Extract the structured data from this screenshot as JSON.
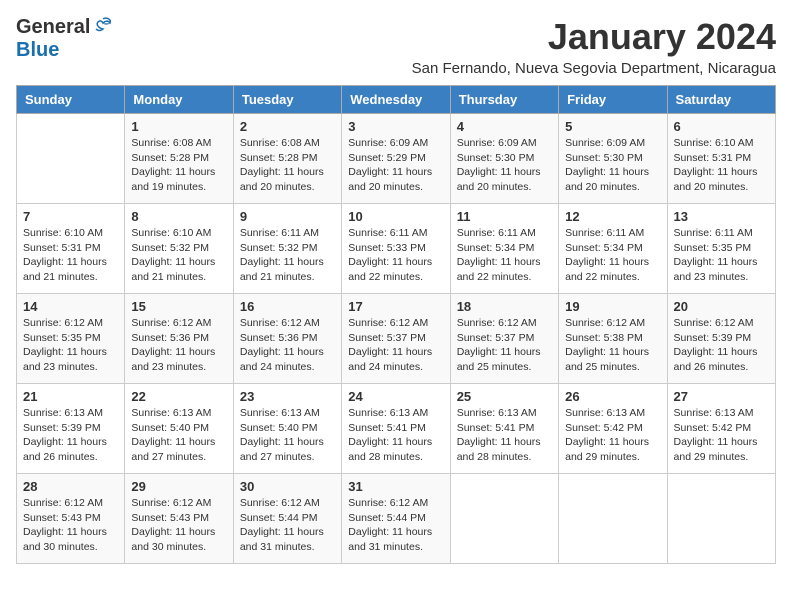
{
  "logo": {
    "general": "General",
    "blue": "Blue"
  },
  "title": "January 2024",
  "location": "San Fernando, Nueva Segovia Department, Nicaragua",
  "headers": [
    "Sunday",
    "Monday",
    "Tuesday",
    "Wednesday",
    "Thursday",
    "Friday",
    "Saturday"
  ],
  "weeks": [
    [
      {
        "day": "",
        "sunrise": "",
        "sunset": "",
        "daylight": ""
      },
      {
        "day": "1",
        "sunrise": "Sunrise: 6:08 AM",
        "sunset": "Sunset: 5:28 PM",
        "daylight": "Daylight: 11 hours and 19 minutes."
      },
      {
        "day": "2",
        "sunrise": "Sunrise: 6:08 AM",
        "sunset": "Sunset: 5:28 PM",
        "daylight": "Daylight: 11 hours and 20 minutes."
      },
      {
        "day": "3",
        "sunrise": "Sunrise: 6:09 AM",
        "sunset": "Sunset: 5:29 PM",
        "daylight": "Daylight: 11 hours and 20 minutes."
      },
      {
        "day": "4",
        "sunrise": "Sunrise: 6:09 AM",
        "sunset": "Sunset: 5:30 PM",
        "daylight": "Daylight: 11 hours and 20 minutes."
      },
      {
        "day": "5",
        "sunrise": "Sunrise: 6:09 AM",
        "sunset": "Sunset: 5:30 PM",
        "daylight": "Daylight: 11 hours and 20 minutes."
      },
      {
        "day": "6",
        "sunrise": "Sunrise: 6:10 AM",
        "sunset": "Sunset: 5:31 PM",
        "daylight": "Daylight: 11 hours and 20 minutes."
      }
    ],
    [
      {
        "day": "7",
        "sunrise": "Sunrise: 6:10 AM",
        "sunset": "Sunset: 5:31 PM",
        "daylight": "Daylight: 11 hours and 21 minutes."
      },
      {
        "day": "8",
        "sunrise": "Sunrise: 6:10 AM",
        "sunset": "Sunset: 5:32 PM",
        "daylight": "Daylight: 11 hours and 21 minutes."
      },
      {
        "day": "9",
        "sunrise": "Sunrise: 6:11 AM",
        "sunset": "Sunset: 5:32 PM",
        "daylight": "Daylight: 11 hours and 21 minutes."
      },
      {
        "day": "10",
        "sunrise": "Sunrise: 6:11 AM",
        "sunset": "Sunset: 5:33 PM",
        "daylight": "Daylight: 11 hours and 22 minutes."
      },
      {
        "day": "11",
        "sunrise": "Sunrise: 6:11 AM",
        "sunset": "Sunset: 5:34 PM",
        "daylight": "Daylight: 11 hours and 22 minutes."
      },
      {
        "day": "12",
        "sunrise": "Sunrise: 6:11 AM",
        "sunset": "Sunset: 5:34 PM",
        "daylight": "Daylight: 11 hours and 22 minutes."
      },
      {
        "day": "13",
        "sunrise": "Sunrise: 6:11 AM",
        "sunset": "Sunset: 5:35 PM",
        "daylight": "Daylight: 11 hours and 23 minutes."
      }
    ],
    [
      {
        "day": "14",
        "sunrise": "Sunrise: 6:12 AM",
        "sunset": "Sunset: 5:35 PM",
        "daylight": "Daylight: 11 hours and 23 minutes."
      },
      {
        "day": "15",
        "sunrise": "Sunrise: 6:12 AM",
        "sunset": "Sunset: 5:36 PM",
        "daylight": "Daylight: 11 hours and 23 minutes."
      },
      {
        "day": "16",
        "sunrise": "Sunrise: 6:12 AM",
        "sunset": "Sunset: 5:36 PM",
        "daylight": "Daylight: 11 hours and 24 minutes."
      },
      {
        "day": "17",
        "sunrise": "Sunrise: 6:12 AM",
        "sunset": "Sunset: 5:37 PM",
        "daylight": "Daylight: 11 hours and 24 minutes."
      },
      {
        "day": "18",
        "sunrise": "Sunrise: 6:12 AM",
        "sunset": "Sunset: 5:37 PM",
        "daylight": "Daylight: 11 hours and 25 minutes."
      },
      {
        "day": "19",
        "sunrise": "Sunrise: 6:12 AM",
        "sunset": "Sunset: 5:38 PM",
        "daylight": "Daylight: 11 hours and 25 minutes."
      },
      {
        "day": "20",
        "sunrise": "Sunrise: 6:12 AM",
        "sunset": "Sunset: 5:39 PM",
        "daylight": "Daylight: 11 hours and 26 minutes."
      }
    ],
    [
      {
        "day": "21",
        "sunrise": "Sunrise: 6:13 AM",
        "sunset": "Sunset: 5:39 PM",
        "daylight": "Daylight: 11 hours and 26 minutes."
      },
      {
        "day": "22",
        "sunrise": "Sunrise: 6:13 AM",
        "sunset": "Sunset: 5:40 PM",
        "daylight": "Daylight: 11 hours and 27 minutes."
      },
      {
        "day": "23",
        "sunrise": "Sunrise: 6:13 AM",
        "sunset": "Sunset: 5:40 PM",
        "daylight": "Daylight: 11 hours and 27 minutes."
      },
      {
        "day": "24",
        "sunrise": "Sunrise: 6:13 AM",
        "sunset": "Sunset: 5:41 PM",
        "daylight": "Daylight: 11 hours and 28 minutes."
      },
      {
        "day": "25",
        "sunrise": "Sunrise: 6:13 AM",
        "sunset": "Sunset: 5:41 PM",
        "daylight": "Daylight: 11 hours and 28 minutes."
      },
      {
        "day": "26",
        "sunrise": "Sunrise: 6:13 AM",
        "sunset": "Sunset: 5:42 PM",
        "daylight": "Daylight: 11 hours and 29 minutes."
      },
      {
        "day": "27",
        "sunrise": "Sunrise: 6:13 AM",
        "sunset": "Sunset: 5:42 PM",
        "daylight": "Daylight: 11 hours and 29 minutes."
      }
    ],
    [
      {
        "day": "28",
        "sunrise": "Sunrise: 6:12 AM",
        "sunset": "Sunset: 5:43 PM",
        "daylight": "Daylight: 11 hours and 30 minutes."
      },
      {
        "day": "29",
        "sunrise": "Sunrise: 6:12 AM",
        "sunset": "Sunset: 5:43 PM",
        "daylight": "Daylight: 11 hours and 30 minutes."
      },
      {
        "day": "30",
        "sunrise": "Sunrise: 6:12 AM",
        "sunset": "Sunset: 5:44 PM",
        "daylight": "Daylight: 11 hours and 31 minutes."
      },
      {
        "day": "31",
        "sunrise": "Sunrise: 6:12 AM",
        "sunset": "Sunset: 5:44 PM",
        "daylight": "Daylight: 11 hours and 31 minutes."
      },
      {
        "day": "",
        "sunrise": "",
        "sunset": "",
        "daylight": ""
      },
      {
        "day": "",
        "sunrise": "",
        "sunset": "",
        "daylight": ""
      },
      {
        "day": "",
        "sunrise": "",
        "sunset": "",
        "daylight": ""
      }
    ]
  ]
}
